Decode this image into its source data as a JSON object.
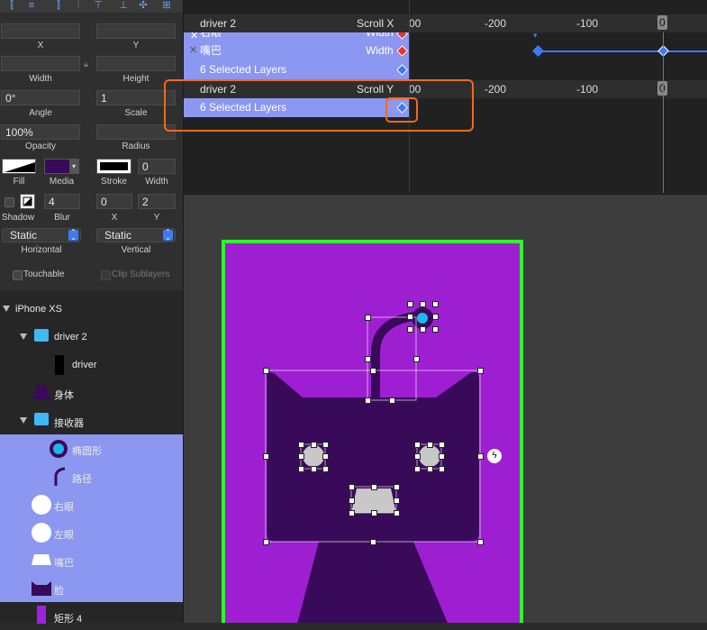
{
  "inspector": {
    "labels": {
      "x": "X",
      "y": "Y",
      "width": "Width",
      "height": "Height",
      "angle": "Angle",
      "scale": "Scale",
      "opacity": "Opacity",
      "radius": "Radius",
      "fill": "Fill",
      "media": "Media",
      "stroke": "Stroke",
      "stroke_width": "Width",
      "shadow": "Shadow",
      "blur": "Blur",
      "shadow_x": "X",
      "shadow_y": "Y",
      "horizontal": "Horizontal",
      "vertical": "Vertical"
    },
    "values": {
      "angle": "0°",
      "scale": "1",
      "opacity": "100%",
      "stroke_width": "0",
      "blur": "4",
      "shadow_x": "0",
      "shadow_y": "2"
    },
    "horizontal_select": "Static",
    "vertical_select": "Static",
    "touchable": "Touchable",
    "clip_sublayers": "Clip Sublayers",
    "colors": {
      "media": "#3a0a5a"
    }
  },
  "layers": {
    "items": [
      {
        "label": "iPhone XS"
      },
      {
        "label": "driver 2"
      },
      {
        "label": "driver"
      },
      {
        "label": "身体"
      },
      {
        "label": "接收器"
      },
      {
        "label": "椭圆形"
      },
      {
        "label": "路径"
      },
      {
        "label": "右眼"
      },
      {
        "label": "左眼"
      },
      {
        "label": "嘴巴"
      },
      {
        "label": "脸"
      },
      {
        "label": "矩形 4"
      }
    ]
  },
  "timeline": {
    "rows": [
      {
        "name": "右眼",
        "prop": "Width"
      },
      {
        "name": "嘴巴",
        "prop": "Width"
      },
      {
        "name": "6 Selected Layers",
        "prop": ""
      },
      {
        "name": "6 Selected Layers",
        "prop": ""
      }
    ],
    "header1": {
      "name": "driver 2",
      "prop": "Scroll X"
    },
    "header2": {
      "name": "driver 2",
      "prop": "Scroll Y"
    },
    "ticks": [
      "00",
      "-200",
      "-100",
      "0"
    ]
  },
  "colors": {
    "accent": "#3b7bf6",
    "selection": "#8b97f0",
    "phone_bg": "#9e1fd1",
    "phone_border": "#2bff2b",
    "face": "#3a0a5a",
    "highlight": "#f26a1b"
  }
}
